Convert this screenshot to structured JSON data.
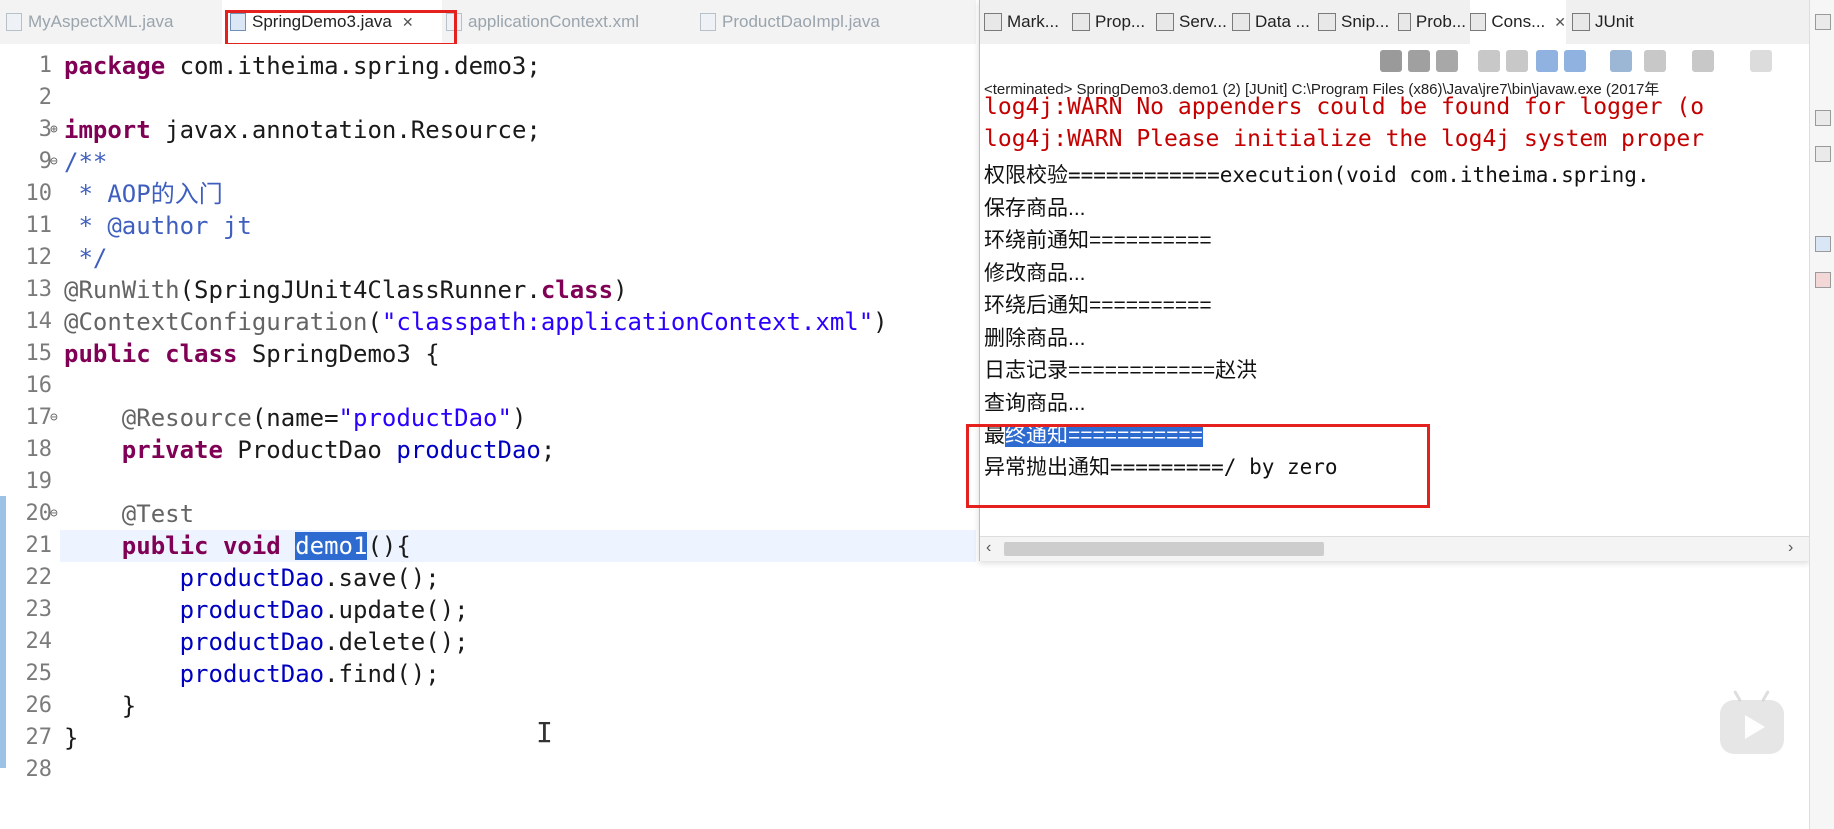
{
  "editor_tabs": [
    {
      "label": "MyAspectXML.java",
      "active": false
    },
    {
      "label": "SpringDemo3.java",
      "active": true
    },
    {
      "label": "applicationContext.xml",
      "active": false
    },
    {
      "label": "ProductDaoImpl.java",
      "active": false
    }
  ],
  "code_lines": [
    {
      "num": "1",
      "segs": [
        {
          "t": "package ",
          "c": "kw"
        },
        {
          "t": "com.itheima.spring.demo3;"
        }
      ]
    },
    {
      "num": "2",
      "segs": []
    },
    {
      "num": "3",
      "segs": [
        {
          "t": "import ",
          "c": "kw"
        },
        {
          "t": "javax.annotation.Resource;"
        }
      ],
      "fold": "⊕"
    },
    {
      "num": "9",
      "segs": [
        {
          "t": "/**",
          "c": "cmt"
        }
      ],
      "fold": "⊖"
    },
    {
      "num": "10",
      "segs": [
        {
          "t": " * AOP的入门",
          "c": "cmt"
        }
      ]
    },
    {
      "num": "11",
      "segs": [
        {
          "t": " * @author jt",
          "c": "cmt"
        }
      ]
    },
    {
      "num": "12",
      "segs": [
        {
          "t": " */",
          "c": "cmt"
        }
      ]
    },
    {
      "num": "13",
      "segs": [
        {
          "t": "@RunWith",
          "c": "ann"
        },
        {
          "t": "(SpringJUnit4ClassRunner."
        },
        {
          "t": "class",
          "c": "kw"
        },
        {
          "t": ")"
        }
      ]
    },
    {
      "num": "14",
      "segs": [
        {
          "t": "@ContextConfiguration",
          "c": "ann"
        },
        {
          "t": "("
        },
        {
          "t": "\"classpath:applicationContext.xml\"",
          "c": "str"
        },
        {
          "t": ")"
        }
      ]
    },
    {
      "num": "15",
      "segs": [
        {
          "t": "public class ",
          "c": "kw"
        },
        {
          "t": "SpringDemo3 {"
        }
      ]
    },
    {
      "num": "16",
      "segs": []
    },
    {
      "num": "17",
      "segs": [
        {
          "t": "    "
        },
        {
          "t": "@Resource",
          "c": "ann"
        },
        {
          "t": "(name="
        },
        {
          "t": "\"productDao\"",
          "c": "str"
        },
        {
          "t": ")"
        }
      ],
      "fold": "⊖"
    },
    {
      "num": "18",
      "segs": [
        {
          "t": "    "
        },
        {
          "t": "private ",
          "c": "kw"
        },
        {
          "t": "ProductDao "
        },
        {
          "t": "productDao",
          "c": "fld"
        },
        {
          "t": ";"
        }
      ]
    },
    {
      "num": "19",
      "segs": []
    },
    {
      "num": "20",
      "segs": [
        {
          "t": "    "
        },
        {
          "t": "@Test",
          "c": "ann"
        }
      ],
      "fold": "⊖"
    },
    {
      "num": "21",
      "segs": [
        {
          "t": "    "
        },
        {
          "t": "public void ",
          "c": "kw"
        },
        {
          "t": "demo1",
          "c": "sel"
        },
        {
          "t": "(){"
        }
      ],
      "current": true
    },
    {
      "num": "22",
      "segs": [
        {
          "t": "        "
        },
        {
          "t": "productDao",
          "c": "fld"
        },
        {
          "t": ".save();"
        }
      ]
    },
    {
      "num": "23",
      "segs": [
        {
          "t": "        "
        },
        {
          "t": "productDao",
          "c": "fld"
        },
        {
          "t": ".update();"
        }
      ]
    },
    {
      "num": "24",
      "segs": [
        {
          "t": "        "
        },
        {
          "t": "productDao",
          "c": "fld"
        },
        {
          "t": ".delete();"
        }
      ]
    },
    {
      "num": "25",
      "segs": [
        {
          "t": "        "
        },
        {
          "t": "productDao",
          "c": "fld"
        },
        {
          "t": ".find();"
        }
      ]
    },
    {
      "num": "26",
      "segs": [
        {
          "t": "    }"
        }
      ]
    },
    {
      "num": "27",
      "segs": [
        {
          "t": "}"
        }
      ]
    },
    {
      "num": "28",
      "segs": []
    }
  ],
  "panel_tabs": [
    {
      "label": "Mark...",
      "icon": "markers-icon"
    },
    {
      "label": "Prop...",
      "icon": "properties-icon"
    },
    {
      "label": "Serv...",
      "icon": "servers-icon"
    },
    {
      "label": "Data ...",
      "icon": "data-source-icon"
    },
    {
      "label": "Snip...",
      "icon": "snippets-icon"
    },
    {
      "label": "Prob...",
      "icon": "problems-icon"
    },
    {
      "label": "Cons...",
      "icon": "console-icon",
      "active": true
    },
    {
      "label": "JUnit",
      "icon": "junit-icon"
    }
  ],
  "console": {
    "terminated": "<terminated> SpringDemo3.demo1 (2) [JUnit] C:\\Program Files (x86)\\Java\\jre7\\bin\\javaw.exe (2017年",
    "lines": [
      {
        "text": "log4j:WARN No appenders could be found for logger (o",
        "type": "err"
      },
      {
        "text": "log4j:WARN Please initialize the log4j system proper",
        "type": "err"
      },
      {
        "text": "权限校验============execution(void com.itheima.spring.",
        "type": "mono"
      },
      {
        "text": "保存商品...",
        "type": "normal"
      },
      {
        "text": "环绕前通知==========",
        "type": "normal"
      },
      {
        "text": "修改商品...",
        "type": "normal"
      },
      {
        "text": "环绕后通知==========",
        "type": "normal"
      },
      {
        "text": "删除商品...",
        "type": "normal"
      },
      {
        "text": "日志记录============赵洪",
        "type": "normal"
      },
      {
        "text": "查询商品...",
        "type": "normal"
      },
      {
        "text_a": "最",
        "text_b": "终通知===========",
        "type": "selected"
      },
      {
        "text": "异常抛出通知=========/ by zero",
        "type": "mono"
      }
    ]
  },
  "icons": {
    "close": "close-icon",
    "scroll_left": "‹",
    "scroll_right": "›"
  },
  "colors": {
    "highlight_box": "#e4211f",
    "selection": "#2e6bd0",
    "keyword": "#7f0055",
    "string": "#2a00ff",
    "error_text": "#c40000"
  }
}
